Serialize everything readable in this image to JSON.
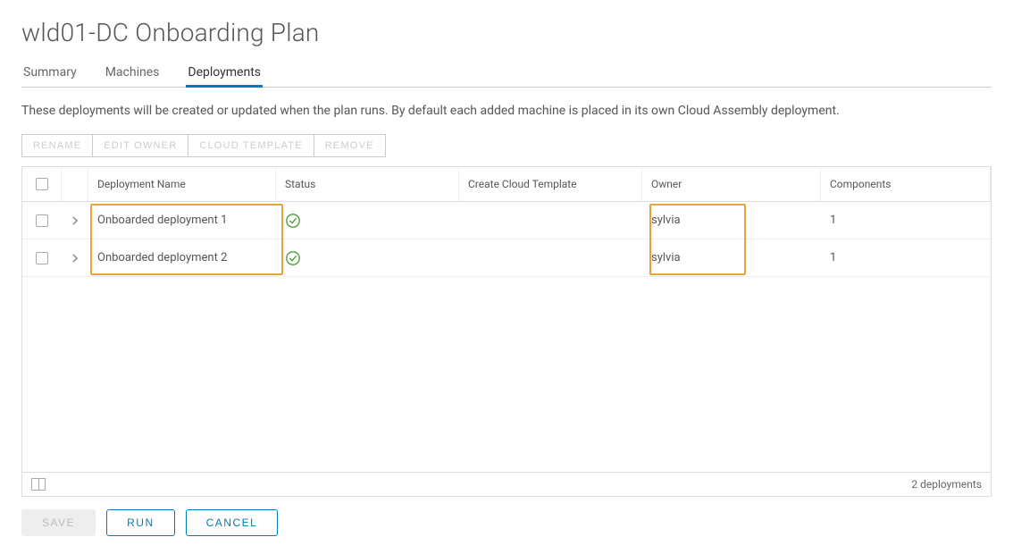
{
  "pageTitle": "wld01-DC Onboarding Plan",
  "tabs": [
    {
      "label": "Summary",
      "active": false
    },
    {
      "label": "Machines",
      "active": false
    },
    {
      "label": "Deployments",
      "active": true
    }
  ],
  "description": "These deployments will be created or updated when the plan runs. By default each added machine is placed in its own Cloud Assembly deployment.",
  "toolbar": {
    "rename": "RENAME",
    "editOwner": "EDIT OWNER",
    "cloudTemplate": "CLOUD TEMPLATE",
    "remove": "REMOVE"
  },
  "columns": {
    "name": "Deployment Name",
    "status": "Status",
    "template": "Create Cloud Template",
    "owner": "Owner",
    "components": "Components"
  },
  "rows": [
    {
      "name": "Onboarded deployment 1",
      "status": "ok",
      "template": "",
      "owner": "sylvia",
      "components": "1"
    },
    {
      "name": "Onboarded deployment 2",
      "status": "ok",
      "template": "",
      "owner": "sylvia",
      "components": "1"
    }
  ],
  "footer": {
    "count": "2 deployments"
  },
  "actions": {
    "save": "SAVE",
    "run": "RUN",
    "cancel": "CANCEL"
  }
}
